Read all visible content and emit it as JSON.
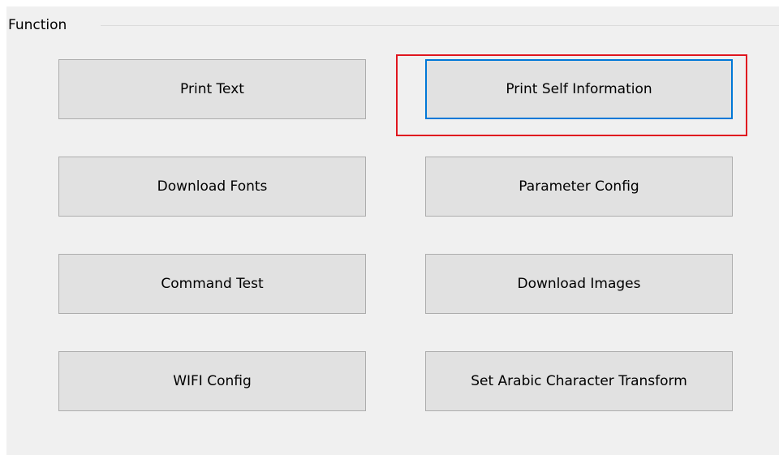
{
  "group": {
    "title": "Function"
  },
  "buttons": {
    "print_text": "Print Text",
    "print_self_information": "Print Self Information",
    "download_fonts": "Download Fonts",
    "parameter_config": "Parameter Config",
    "command_test": "Command Test",
    "download_images": "Download Images",
    "wifi_config": "WIFI Config",
    "set_arabic_character_transform": "Set Arabic Character Transform"
  },
  "focused_button": "Print Self Information",
  "colors": {
    "panel_background": "#f0f0f0",
    "button_face": "#e1e1e1",
    "button_border": "#adadad",
    "focus_border": "#0078d7",
    "highlight_annotation": "#e0161f"
  }
}
